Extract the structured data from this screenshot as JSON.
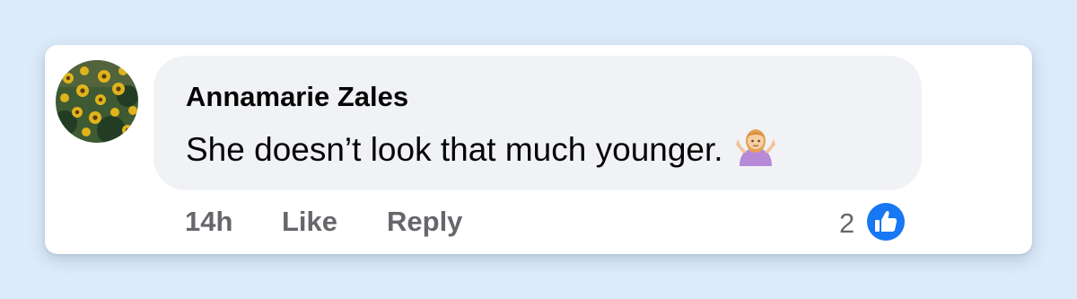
{
  "comment": {
    "author": "Annamarie Zales",
    "text": "She doesn’t look that much younger.",
    "emoji": "person-shrugging-emoji",
    "avatar_icon": "sunflower-field-avatar"
  },
  "actions": {
    "timestamp": "14h",
    "like_label": "Like",
    "reply_label": "Reply"
  },
  "reactions": {
    "count": "2",
    "icon": "thumbs-up-icon",
    "color": "#1877f2"
  },
  "colors": {
    "page_background": "#dcebf9",
    "bubble_background": "#f0f2f5",
    "secondary_text": "#65676b"
  }
}
